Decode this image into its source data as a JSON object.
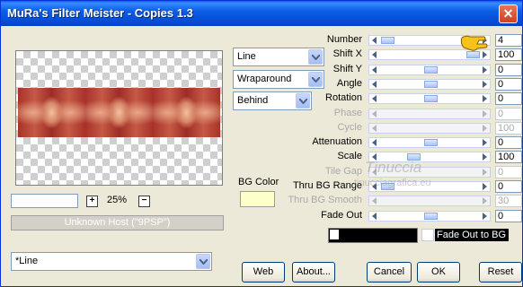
{
  "window": {
    "title": "MuRa's Filter Meister - Copies 1.3"
  },
  "zoom": {
    "value": "25%",
    "plus": "+",
    "minus": "−"
  },
  "host": "Unknown Host (\"9PSP\")",
  "dropdowns": {
    "shape": "Line",
    "edge": "Wraparound",
    "order": "Behind",
    "preset": "*Line"
  },
  "bg_color": {
    "label": "BG Color",
    "color": "#ffffcc"
  },
  "params": [
    {
      "label": "Number",
      "value": "4",
      "enabled": true,
      "thumb": 0.0
    },
    {
      "label": "Shift X",
      "value": "100",
      "enabled": true,
      "thumb": 1.0
    },
    {
      "label": "Shift Y",
      "value": "0",
      "enabled": true,
      "thumb": 0.5
    },
    {
      "label": "Angle",
      "value": "0",
      "enabled": true,
      "thumb": 0.5
    },
    {
      "label": "Rotation",
      "value": "0",
      "enabled": true,
      "thumb": 0.5
    },
    {
      "label": "Phase",
      "value": "0",
      "enabled": false,
      "thumb": 0.5
    },
    {
      "label": "Cycle",
      "value": "100",
      "enabled": false,
      "thumb": 0.5
    },
    {
      "label": "Attenuation",
      "value": "0",
      "enabled": true,
      "thumb": 0.5
    },
    {
      "label": "Scale",
      "value": "100",
      "enabled": true,
      "thumb": 0.3
    },
    {
      "label": "Tile Gap",
      "value": "0",
      "enabled": false,
      "thumb": 0.5
    },
    {
      "label": "Thru BG Range",
      "value": "0",
      "enabled": true,
      "thumb": 0.0
    },
    {
      "label": "Thru BG Smooth",
      "value": "30",
      "enabled": false,
      "thumb": 0.5
    },
    {
      "label": "Fade Out",
      "value": "0",
      "enabled": true,
      "thumb": 0.5
    }
  ],
  "fade_to_bg": {
    "label": "Fade Out to BG"
  },
  "buttons": {
    "web": "Web",
    "about": "About...",
    "cancel": "Cancel",
    "ok": "OK",
    "reset": "Reset"
  },
  "watermark": {
    "line1": "Tinuccia",
    "line2": "tinucciagrafica.eu"
  }
}
